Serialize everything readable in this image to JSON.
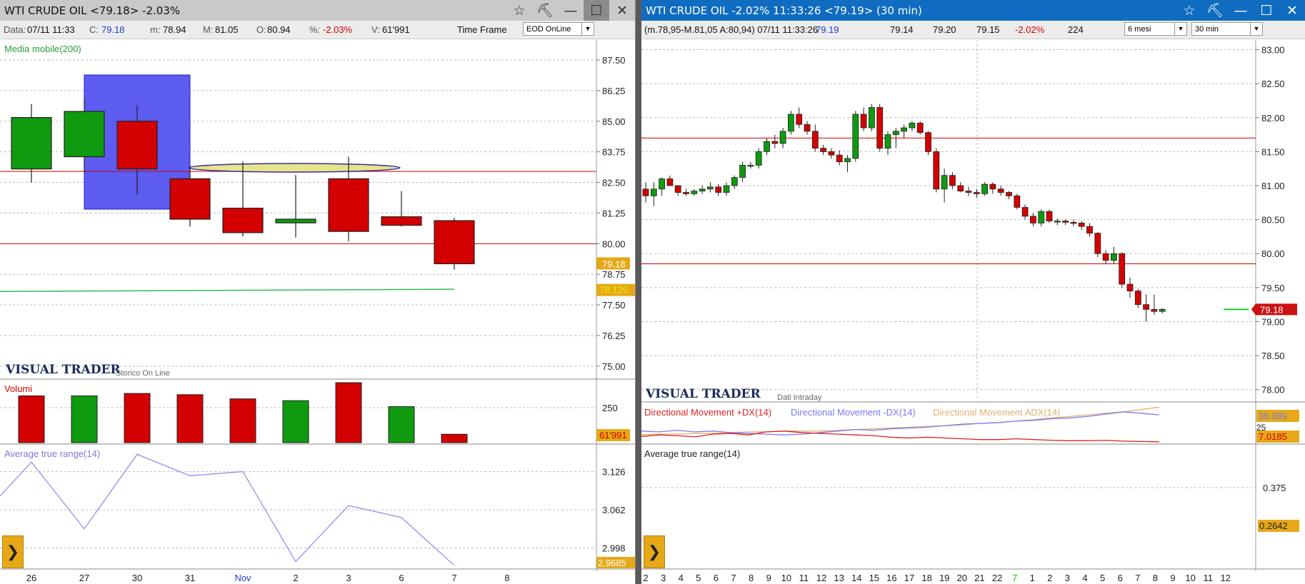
{
  "left": {
    "title": "WTI CRUDE OIL <79.18> -2.03%",
    "info": {
      "data_label": "Data:",
      "data_value": "07/11 11:33",
      "c_label": "C:",
      "c_value": "79.18",
      "m_label": "m:",
      "m_value": "78.94",
      "M_label": "M:",
      "M_value": "81.05",
      "o_label": "O:",
      "o_value": "80.94",
      "pct_label": "%:",
      "pct_value": "-2.03%",
      "v_label": "V:",
      "v_value": "61'991",
      "timeframe_label": "Time Frame",
      "timeframe_select": "EOD OnLine"
    },
    "ma_label": "Media mobile(200)",
    "watermark": "VISUAL TRADER",
    "watermark_sub": "Storico On Line",
    "volume_label": "Volumi",
    "atr_label": "Average true range(14)",
    "price_ticks": [
      "87.50",
      "86.25",
      "85.00",
      "83.75",
      "82.50",
      "81.25",
      "80.00",
      "78.75",
      "77.50",
      "76.25",
      "75.00"
    ],
    "price_badge": "79.18",
    "ma_badge": "78.125",
    "volume_tick": "250",
    "volume_badge": "61'991",
    "atr_ticks": [
      "3.126",
      "3.062",
      "2.998"
    ],
    "atr_badge": "2.9685",
    "x_labels": [
      "26",
      "27",
      "30",
      "31",
      "Nov",
      "2",
      "3",
      "6",
      "7",
      "8"
    ]
  },
  "right": {
    "title": "WTI CRUDE OIL -2.02% 11:33:26  <79.19> (30 min)",
    "info": {
      "ohl": "(m.78,95-M.81,05 A:80,94) 07/11 11:33:26",
      "last": "79.19",
      "bid": "79.14",
      "ask": "79.20",
      "v3": "79.15",
      "pct": "-2.02%",
      "count": "224",
      "period_select": "6 mesi",
      "interval_select": "30 min"
    },
    "watermark": "VISUAL TRADER",
    "watermark_sub": "Dati Intraday",
    "price_ticks": [
      "83.00",
      "82.50",
      "82.00",
      "81.50",
      "81.00",
      "80.50",
      "80.00",
      "79.50",
      "79.00",
      "78.50",
      "78.00"
    ],
    "price_badge": "79.18",
    "dm_plus_label": "Directional Movement +DX(14)",
    "dm_minus_label": "Directional Movement -DX(14)",
    "adx_label": "Directional Movement ADX(14)",
    "dm_tick": "25",
    "dm_badge1": "36.389",
    "dm_badge2": "7.0185",
    "atr_label": "Average true range(14)",
    "atr_tick": "0.375",
    "atr_badge": "0.2642",
    "x_labels": [
      "2",
      "3",
      "4",
      "5",
      "6",
      "7",
      "8",
      "9",
      "10",
      "11",
      "12",
      "13",
      "14",
      "15",
      "16",
      "17",
      "18",
      "19",
      "20",
      "21",
      "22",
      "7",
      "1",
      "2",
      "3",
      "4",
      "5",
      "6",
      "7",
      "8",
      "9",
      "10",
      "11",
      "12"
    ]
  },
  "colors": {
    "up": "#0f9a0f",
    "down": "#d40000",
    "selection": "#4a4af0",
    "ma": "#33bb55",
    "atr": "#9090f0",
    "dm_plus": "#e02020",
    "dm_minus": "#7a7af0",
    "adx": "#e0b070",
    "badge": "#e6a817",
    "badge_red": "#cc1111"
  },
  "chart_data": [
    {
      "type": "candlestick",
      "title": "WTI CRUDE OIL",
      "categories": [
        "26",
        "27",
        "30",
        "31",
        "Nov",
        "2",
        "3",
        "6",
        "7"
      ],
      "open": [
        83.05,
        83.55,
        85.0,
        82.65,
        81.45,
        80.85,
        82.65,
        81.1,
        80.94
      ],
      "high": [
        85.7,
        85.95,
        85.65,
        83.2,
        83.35,
        82.8,
        83.55,
        82.15,
        81.05
      ],
      "low": [
        82.5,
        82.9,
        82.0,
        80.7,
        80.3,
        80.25,
        80.1,
        80.7,
        78.94
      ],
      "close": [
        85.15,
        85.4,
        83.05,
        81.0,
        80.45,
        81.0,
        80.5,
        80.75,
        79.18
      ],
      "volume_up": [
        false,
        true,
        false,
        false,
        false,
        true,
        false,
        true,
        false
      ],
      "ylim": [
        74.5,
        88.2
      ],
      "h_lines": [
        82.95,
        80.0
      ],
      "ma200": {
        "name": "Media mobile(200)",
        "from": 78.05,
        "to": 78.14
      },
      "volumes": [
        0.78,
        0.78,
        0.82,
        0.8,
        0.73,
        0.7,
        1.0,
        0.6,
        0.14
      ],
      "atr": [
        3.085,
        3.142,
        3.03,
        3.155,
        3.119,
        3.126,
        2.975,
        3.069,
        3.049,
        2.9685
      ],
      "atr_ylim": [
        2.965,
        3.165
      ]
    },
    {
      "type": "candlestick",
      "title": "WTI CRUDE OIL (30 min)",
      "ylim": [
        77.85,
        83.1
      ],
      "h_lines": [
        81.7,
        79.85
      ],
      "candles": [
        [
          80.95,
          81.05,
          80.75,
          80.85
        ],
        [
          80.85,
          81.05,
          80.7,
          80.95
        ],
        [
          80.95,
          81.12,
          80.85,
          81.1
        ],
        [
          81.1,
          81.15,
          81.0,
          81.0
        ],
        [
          81.0,
          81.0,
          80.85,
          80.9
        ],
        [
          80.9,
          80.95,
          80.85,
          80.88
        ],
        [
          80.88,
          80.95,
          80.85,
          80.92
        ],
        [
          80.92,
          81.0,
          80.88,
          80.95
        ],
        [
          80.95,
          81.05,
          80.9,
          80.98
        ],
        [
          80.98,
          81.02,
          80.85,
          80.9
        ],
        [
          80.9,
          81.05,
          80.85,
          81.0
        ],
        [
          81.0,
          81.15,
          80.95,
          81.12
        ],
        [
          81.12,
          81.35,
          81.05,
          81.3
        ],
        [
          81.3,
          81.35,
          81.25,
          81.3
        ],
        [
          81.3,
          81.55,
          81.25,
          81.5
        ],
        [
          81.5,
          81.7,
          81.45,
          81.65
        ],
        [
          81.65,
          81.75,
          81.55,
          81.62
        ],
        [
          81.62,
          81.85,
          81.55,
          81.8
        ],
        [
          81.8,
          82.1,
          81.75,
          82.05
        ],
        [
          82.05,
          82.15,
          81.85,
          81.9
        ],
        [
          81.9,
          81.95,
          81.75,
          81.8
        ],
        [
          81.8,
          81.9,
          81.5,
          81.55
        ],
        [
          81.55,
          81.6,
          81.45,
          81.5
        ],
        [
          81.5,
          81.55,
          81.4,
          81.45
        ],
        [
          81.45,
          81.52,
          81.3,
          81.35
        ],
        [
          81.35,
          81.45,
          81.2,
          81.4
        ],
        [
          81.4,
          82.1,
          81.35,
          82.05
        ],
        [
          82.05,
          82.15,
          81.8,
          81.85
        ],
        [
          81.85,
          82.2,
          81.8,
          82.15
        ],
        [
          82.15,
          82.2,
          81.5,
          81.55
        ],
        [
          81.55,
          81.8,
          81.45,
          81.75
        ],
        [
          81.75,
          81.85,
          81.55,
          81.8
        ],
        [
          81.8,
          81.9,
          81.7,
          81.85
        ],
        [
          81.85,
          81.95,
          81.8,
          81.92
        ],
        [
          81.92,
          81.95,
          81.75,
          81.78
        ],
        [
          81.78,
          81.8,
          81.45,
          81.5
        ],
        [
          81.5,
          81.55,
          80.9,
          80.95
        ],
        [
          80.95,
          81.25,
          80.75,
          81.15
        ],
        [
          81.15,
          81.2,
          80.95,
          81.0
        ],
        [
          81.0,
          81.05,
          80.9,
          80.92
        ],
        [
          80.92,
          80.98,
          80.85,
          80.9
        ],
        [
          80.9,
          80.95,
          80.82,
          80.88
        ],
        [
          80.88,
          81.05,
          80.85,
          81.02
        ],
        [
          81.02,
          81.05,
          80.88,
          80.95
        ],
        [
          80.95,
          81.0,
          80.85,
          80.9
        ],
        [
          80.9,
          80.92,
          80.8,
          80.85
        ],
        [
          80.85,
          80.88,
          80.65,
          80.68
        ],
        [
          80.68,
          80.72,
          80.5,
          80.55
        ],
        [
          80.55,
          80.6,
          80.4,
          80.45
        ],
        [
          80.45,
          80.65,
          80.4,
          80.62
        ],
        [
          80.62,
          80.65,
          80.45,
          80.48
        ],
        [
          80.48,
          80.52,
          80.42,
          80.48
        ],
        [
          80.48,
          80.5,
          80.42,
          80.46
        ],
        [
          80.46,
          80.5,
          80.4,
          80.45
        ],
        [
          80.45,
          80.48,
          80.35,
          80.4
        ],
        [
          80.4,
          80.45,
          80.25,
          80.3
        ],
        [
          80.3,
          80.32,
          79.95,
          80.0
        ],
        [
          80.0,
          80.05,
          79.85,
          79.9
        ],
        [
          79.9,
          80.1,
          79.85,
          80.0
        ],
        [
          80.0,
          80.02,
          79.5,
          79.55
        ],
        [
          79.55,
          79.65,
          79.35,
          79.45
        ],
        [
          79.45,
          79.48,
          79.2,
          79.25
        ],
        [
          79.25,
          79.4,
          79.0,
          79.18
        ],
        [
          79.18,
          79.4,
          79.1,
          79.15
        ],
        [
          79.15,
          79.2,
          79.12,
          79.18
        ]
      ],
      "dm_plus": [
        0.16,
        0.2,
        0.18,
        0.15,
        0.22,
        0.24,
        0.2,
        0.28,
        0.3,
        0.26,
        0.24,
        0.22,
        0.2,
        0.18,
        0.14,
        0.12,
        0.14,
        0.12,
        0.1,
        0.08,
        0.08,
        0.1,
        0.08,
        0.06,
        0.05,
        0.05,
        0.06,
        0.04,
        0.03,
        0.02
      ],
      "dm_minus": [
        0.3,
        0.28,
        0.32,
        0.28,
        0.3,
        0.26,
        0.24,
        0.22,
        0.2,
        0.22,
        0.26,
        0.3,
        0.34,
        0.32,
        0.36,
        0.38,
        0.4,
        0.44,
        0.48,
        0.5,
        0.52,
        0.56,
        0.58,
        0.62,
        0.64,
        0.68,
        0.74,
        0.8,
        0.76,
        0.72
      ],
      "adx": [
        0.2,
        0.22,
        0.22,
        0.24,
        0.24,
        0.26,
        0.28,
        0.28,
        0.3,
        0.3,
        0.3,
        0.32,
        0.34,
        0.36,
        0.38,
        0.4,
        0.42,
        0.44,
        0.46,
        0.5,
        0.52,
        0.56,
        0.6,
        0.64,
        0.68,
        0.72,
        0.76,
        0.8,
        0.86,
        0.92
      ]
    }
  ]
}
